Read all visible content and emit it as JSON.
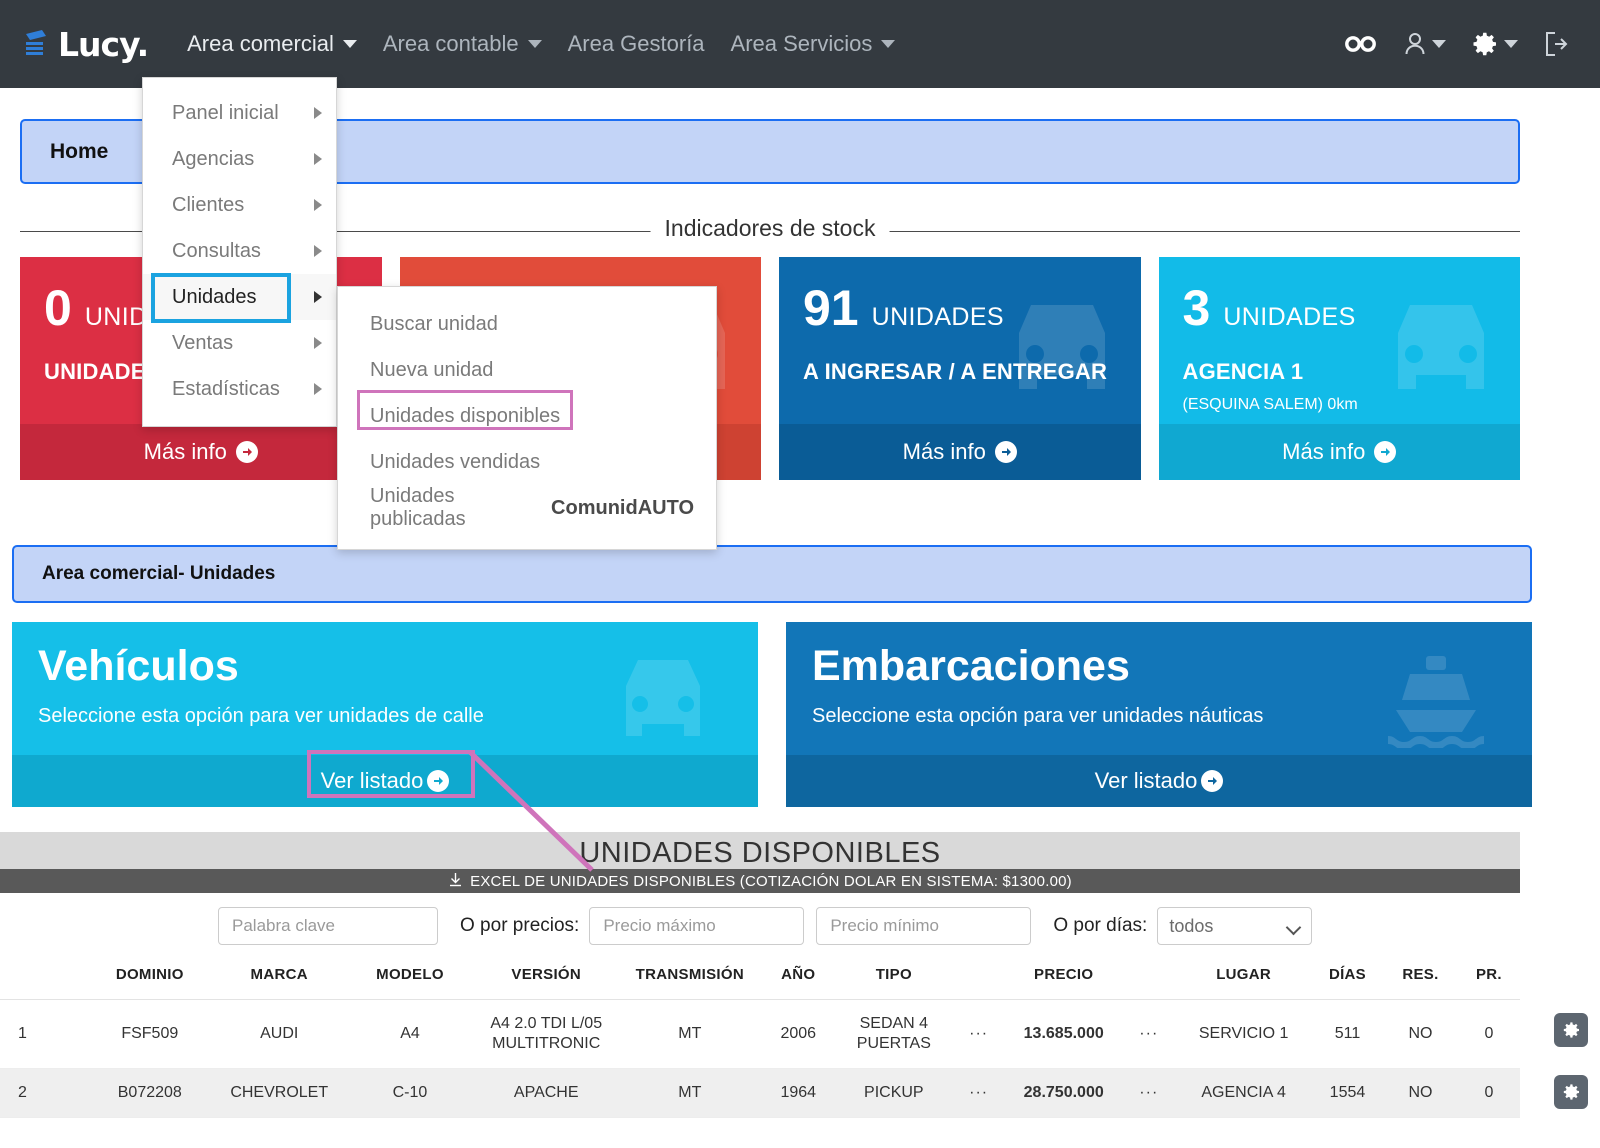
{
  "header": {
    "brand": "Lucy.",
    "nav": [
      {
        "label": "Area comercial",
        "active": true,
        "caret": true
      },
      {
        "label": "Area contable",
        "active": false,
        "caret": true
      },
      {
        "label": "Area Gestoría",
        "active": false,
        "caret": false
      },
      {
        "label": "Area Servicios",
        "active": false,
        "caret": true
      }
    ],
    "icons": [
      "infinity-icon",
      "user-icon",
      "gear-icon",
      "logout-icon"
    ]
  },
  "homebar": {
    "label": "Home"
  },
  "stock_section": {
    "legend": "Indicadores de stock"
  },
  "cards": [
    {
      "number": "0",
      "units": "UNIDADES",
      "subtitle": "UNIDADES A I",
      "sub2": "",
      "more": "Más info",
      "bg": "#dc2f44",
      "foot": "#c4283c"
    },
    {
      "number": "",
      "units": "",
      "subtitle": "",
      "sub2": "",
      "more": "",
      "bg": "#e14c3a",
      "foot": "#ce4232"
    },
    {
      "number": "91",
      "units": "UNIDADES",
      "subtitle": "A INGRESAR / A ENTREGAR",
      "sub2": "",
      "more": "Más info",
      "bg": "#0d6aac",
      "foot": "#0a5c96"
    },
    {
      "number": "3",
      "units": "UNIDADES",
      "subtitle": "AGENCIA 1",
      "sub2": "(ESQUINA SALEM) 0km",
      "more": "Más info",
      "bg": "#12bbe8",
      "foot": "#10a8d1"
    }
  ],
  "breadcrumb": {
    "label": "Area comercial- Unidades"
  },
  "panels": [
    {
      "title": "Vehículos",
      "desc": "Seleccione esta opción para ver unidades de calle",
      "cta": "Ver listado",
      "bg": "#15bfe8",
      "foot": "#0fa9cf",
      "icon": "car-icon"
    },
    {
      "title": "Embarcaciones",
      "desc": "Seleccione esta opción para ver unidades náuticas",
      "cta": "Ver listado",
      "bg": "#1276b8",
      "foot": "#0e669f",
      "icon": "boat-icon"
    }
  ],
  "menu1": {
    "items": [
      {
        "label": "Panel inicial",
        "selected": false
      },
      {
        "label": "Agencias",
        "selected": false
      },
      {
        "label": "Clientes",
        "selected": false
      },
      {
        "label": "Consultas",
        "selected": false
      },
      {
        "label": "Unidades",
        "selected": true
      },
      {
        "label": "Ventas",
        "selected": false
      },
      {
        "label": "Estadísticas",
        "selected": false
      }
    ]
  },
  "menu2": {
    "items": [
      {
        "label": "Buscar unidad",
        "bold": ""
      },
      {
        "label": "Nueva unidad",
        "bold": ""
      },
      {
        "label": "Unidades disponibles",
        "bold": ""
      },
      {
        "label": "Unidades vendidas",
        "bold": ""
      },
      {
        "label": "Unidades publicadas ",
        "bold": "ComunidAUTO"
      }
    ]
  },
  "table_section": {
    "title": "UNIDADES DISPONIBLES",
    "excel_link": "EXCEL DE UNIDADES DISPONIBLES (COTIZACIÓN DOLAR EN SISTEMA: $1300.00)",
    "filters": {
      "keyword_placeholder": "Palabra clave",
      "price_label": "O por precios:",
      "price_max_placeholder": "Precio máximo",
      "price_min_placeholder": "Precio mínimo",
      "days_label": "O por días:",
      "days_value": "todos",
      "days_options": [
        "todos"
      ]
    },
    "columns": [
      "",
      "",
      "DOMINIO",
      "MARCA",
      "MODELO",
      "VERSIÓN",
      "TRANSMISIÓN",
      "AÑO",
      "TIPO",
      "",
      "PRECIO",
      "",
      "LUGAR",
      "DÍAS",
      "RES.",
      "PR."
    ],
    "rows": [
      {
        "idx": "1",
        "blank": "",
        "dominio": "FSF509",
        "marca": "AUDI",
        "modelo": "A4",
        "version": "A4 2.0 TDI L/05 MULTITRONIC",
        "transmision": "MT",
        "anio": "2006",
        "tipo": "SEDAN 4 PUERTAS",
        "dots1": "···",
        "precio": "13.685.000",
        "dots2": "···",
        "lugar": "SERVICIO 1",
        "dias": "511",
        "res": "NO",
        "pr": "0"
      },
      {
        "idx": "2",
        "blank": "",
        "dominio": "B072208",
        "marca": "CHEVROLET",
        "modelo": "C-10",
        "version": "APACHE",
        "transmision": "MT",
        "anio": "1964",
        "tipo": "PICKUP",
        "dots1": "···",
        "precio": "28.750.000",
        "dots2": "···",
        "lugar": "AGENCIA 4",
        "dias": "1554",
        "res": "NO",
        "pr": "0"
      }
    ]
  },
  "annotations": {
    "highlight_color": "#cf74bb",
    "select_color": "#1ba3e0"
  }
}
